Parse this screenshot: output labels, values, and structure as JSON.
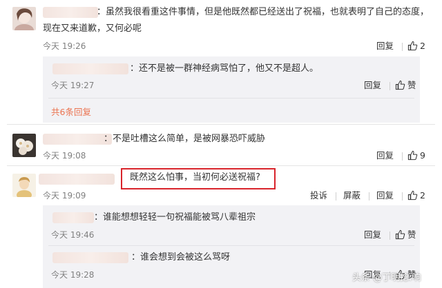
{
  "comments": [
    {
      "text_line1": "：虽然我很看重这件事情，但是他既然都已经送出了祝福，也就表明了自己的态度，",
      "text_line2": "现在又来道歉，又何必呢",
      "time": "今天 19:26",
      "reply_label": "回复",
      "likes": "2",
      "replies": [
        {
          "text": "：还不是被一群神经病骂怕了，他又不是超人。",
          "time": "今天 19:27",
          "reply_label": "回复",
          "like_label": "赞"
        }
      ],
      "more_replies": "共6条回复"
    },
    {
      "text": "：不是吐槽这么简单，是被网暴恐吓威胁",
      "time": "今天 19:08",
      "reply_label": "回复",
      "likes": "9"
    },
    {
      "text": "既然这么怕事，当初何必送祝福?",
      "time": "今天 19:09",
      "report_label": "投诉",
      "block_label": "屏蔽",
      "reply_label": "回复",
      "likes": "2",
      "replies": [
        {
          "text": "：谁能想想轻轻一句祝福能被骂八辈祖宗",
          "time": "今天 19:46",
          "reply_label": "回复",
          "like_label": "赞"
        },
        {
          "text": "：谁会想到会被这么骂呀",
          "time": "今天 19:28",
          "reply_label": "回复",
          "like_label": "赞"
        }
      ]
    }
  ],
  "watermark": "头条 @丁明捻:响",
  "colors": {
    "link_orange": "#eb7350",
    "highlight_red": "#d8232a",
    "reply_bg": "#f2f2f5"
  },
  "icons": [
    "thumb-up-icon",
    "avatar"
  ]
}
